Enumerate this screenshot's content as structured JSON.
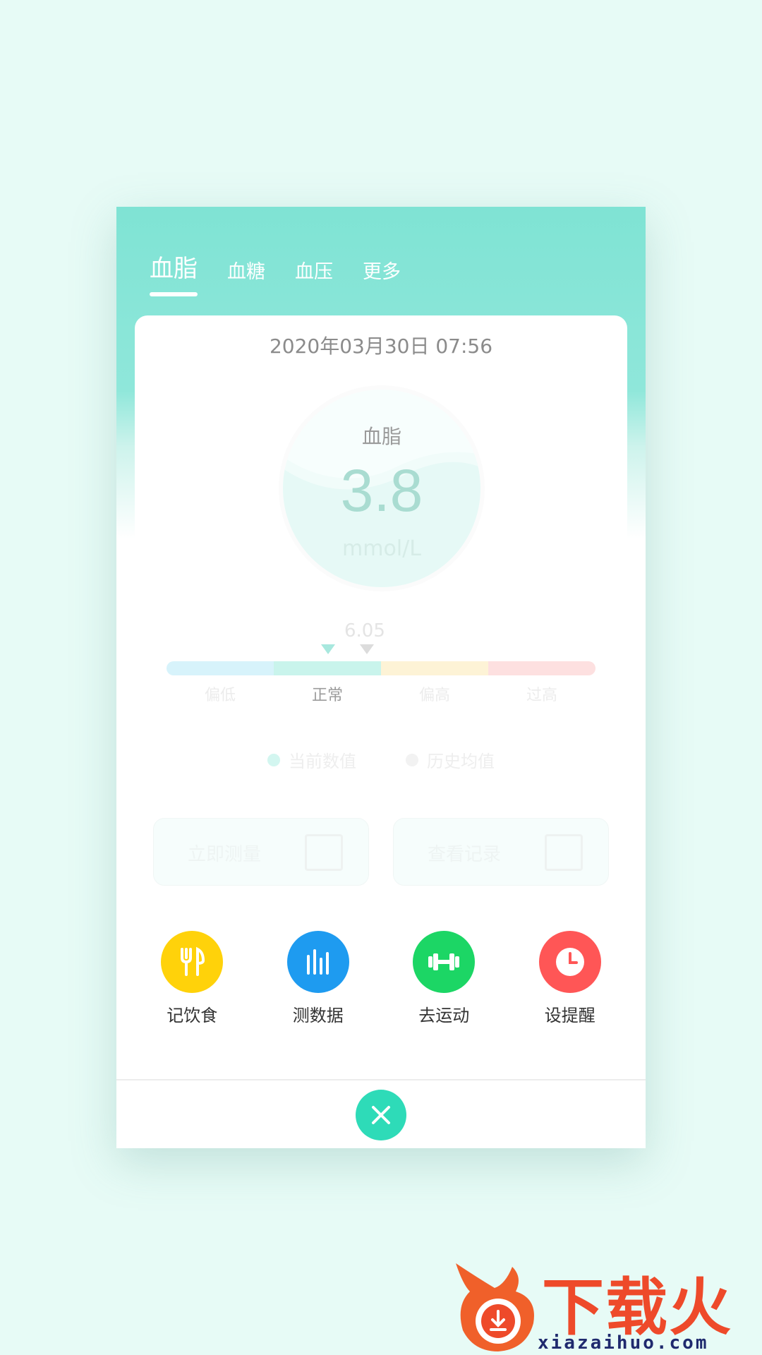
{
  "tabs": [
    {
      "label": "血脂",
      "active": true
    },
    {
      "label": "血糖",
      "active": false
    },
    {
      "label": "血压",
      "active": false
    },
    {
      "label": "更多",
      "active": false
    }
  ],
  "reading": {
    "datetime": "2020年03月30日 07:56",
    "label": "血脂",
    "value": "3.8",
    "unit": "mmol/L"
  },
  "range": {
    "marker_value": "6.05",
    "segments": [
      {
        "label": "偏低",
        "color": "#d7f3fb"
      },
      {
        "label": "正常",
        "color": "#c9f4ec"
      },
      {
        "label": "偏高",
        "color": "#fdf3d6"
      },
      {
        "label": "过高",
        "color": "#fde0e0"
      }
    ],
    "active_segment": "正常"
  },
  "legend": [
    {
      "label": "当前数值",
      "color": "#d3f6f0"
    },
    {
      "label": "历史均值",
      "color": "#f2f2f2"
    }
  ],
  "actions": {
    "measure_label": "立即测量",
    "records_label": "查看记录"
  },
  "quick_actions": [
    {
      "label": "记饮食",
      "color": "#ffd20a",
      "icon": "fork-knife-icon"
    },
    {
      "label": "测数据",
      "color": "#1e9bf0",
      "icon": "bar-chart-icon"
    },
    {
      "label": "去运动",
      "color": "#1cd665",
      "icon": "dumbbell-icon"
    },
    {
      "label": "设提醒",
      "color": "#ff5656",
      "icon": "clock-icon"
    }
  ],
  "watermark": {
    "main": "下载火",
    "sub": "xiazaihuo.com"
  }
}
